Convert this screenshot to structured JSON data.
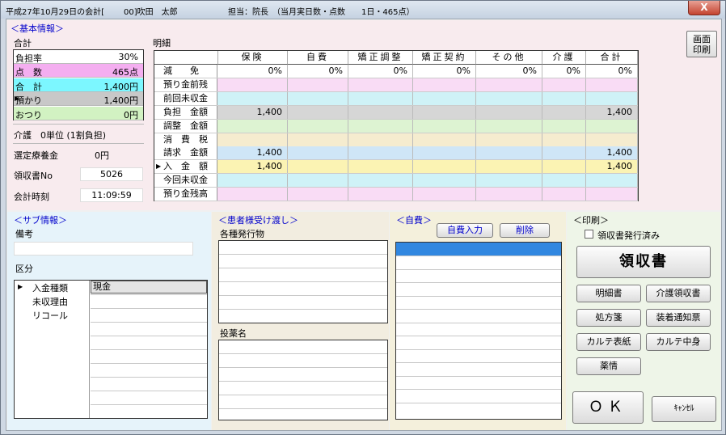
{
  "titlebar": {
    "title": "平成27年10月29日の会計[",
    "patient": "00]吹田　太郎",
    "staff": "担当：院長",
    "stats": "（当月実日数・点数　　1日・465点）"
  },
  "basic": {
    "section_title": "＜基本情報＞",
    "total_label": "合計",
    "print_screen_label": [
      "画面",
      "印刷"
    ],
    "summary": [
      {
        "label": "負担率",
        "value": "30%",
        "color": "#ffffff"
      },
      {
        "label": "点　数",
        "value": "465点",
        "color": "#f4aef0"
      },
      {
        "label": "合　計",
        "value": "1,400円",
        "color": "#7cf7ff"
      },
      {
        "label": "預かり",
        "value": "1,400円",
        "color": "#c8c8c8",
        "pointer": "▶"
      },
      {
        "label": "おつり",
        "value": "0円",
        "color": "#d2f2c2"
      }
    ],
    "care_label": "介護　0単位 (1割負担)",
    "selected_fee_label": "選定療養金",
    "selected_fee_value": "0円",
    "receipt_no_label": "領収書No",
    "receipt_no_value": "5026",
    "time_label": "会計時刻",
    "time_value": "11:09:59"
  },
  "detail": {
    "title": "明細",
    "columns": [
      "保険",
      "自費",
      "矯正調整",
      "矯正契約",
      "その他",
      "介護",
      "合計"
    ],
    "rows": [
      {
        "label": "減　　免",
        "color": "#ffffff",
        "values": [
          "0%",
          "0%",
          "0%",
          "0%",
          "0%",
          "0%",
          "0%"
        ]
      },
      {
        "label": "預り金前残",
        "color": "#f9dcf5",
        "values": [
          "",
          "",
          "",
          "",
          "",
          "",
          ""
        ]
      },
      {
        "label": "前回未収金",
        "color": "#cff2f7",
        "values": [
          "",
          "",
          "",
          "",
          "",
          "",
          ""
        ]
      },
      {
        "label": "負担　金額",
        "color": "#d6d6d6",
        "values": [
          "1,400",
          "",
          "",
          "",
          "",
          "",
          "1,400"
        ]
      },
      {
        "label": "調整　金額",
        "color": "#ddf3d2",
        "values": [
          "",
          "",
          "",
          "",
          "",
          "",
          ""
        ]
      },
      {
        "label": "消　費　税",
        "color": "#f5eccf",
        "values": [
          "",
          "",
          "",
          "",
          "",
          "",
          ""
        ]
      },
      {
        "label": "請求　金額",
        "color": "#cfe6f7",
        "values": [
          "1,400",
          "",
          "",
          "",
          "",
          "",
          "1,400"
        ]
      },
      {
        "label": "入　金　額",
        "color": "#fbf3b3",
        "pointer": "▶",
        "values": [
          "1,400",
          "",
          "",
          "",
          "",
          "",
          "1,400"
        ]
      },
      {
        "label": "今回未収金",
        "color": "#cff2f7",
        "values": [
          "",
          "",
          "",
          "",
          "",
          "",
          ""
        ]
      },
      {
        "label": "預り金残高",
        "color": "#f9dcf5",
        "values": [
          "",
          "",
          "",
          "",
          "",
          "",
          ""
        ]
      }
    ]
  },
  "sub": {
    "section_title": "＜サブ情報＞",
    "note_label": "備考",
    "note_value": "",
    "category_label": "区分",
    "categories": [
      "入金種類",
      "未収理由",
      "リコール"
    ],
    "category_pointer": "▶",
    "category_value": "現金"
  },
  "patient": {
    "section_title": "＜患者様受け渡し＞",
    "documents_label": "各種発行物",
    "medicine_label": "投薬名"
  },
  "self_pay": {
    "section_title": "＜自費＞",
    "input_button": "自費入力",
    "delete_button": "削除"
  },
  "print": {
    "section_title": "＜印刷＞",
    "issued_checkbox_label": "領収書発行済み",
    "issued_checked": false,
    "receipt_button": "領収書",
    "buttons": [
      "明細書",
      "介護領収書",
      "処方箋",
      "装着通知票",
      "カルテ表紙",
      "カルテ中身",
      "薬情"
    ]
  },
  "actions": {
    "ok": "ＯＫ",
    "cancel": "ｷｬﾝｾﾙ",
    "close": "X"
  }
}
